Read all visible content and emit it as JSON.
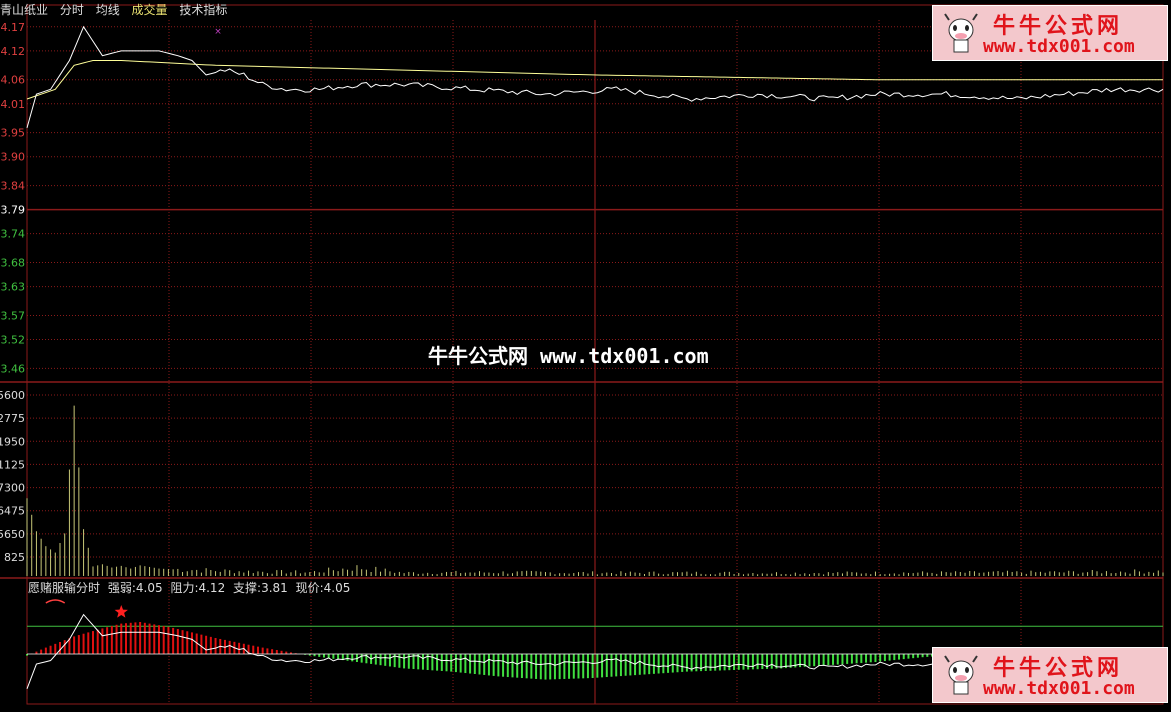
{
  "header": {
    "stock_name": "青山纸业",
    "tab_minute": "分时",
    "tab_avg": "均线",
    "tab_volume": "成交量",
    "tab_tech": "技术指标"
  },
  "indicator_header": {
    "name": "愿赌服输分时",
    "strength": "强弱:4.05",
    "resistance": "阻力:4.12",
    "support": "支撑:3.81",
    "current": "现价:4.05"
  },
  "watermark": "牛牛公式网 www.tdx001.com",
  "logos": [
    {
      "title": "牛牛公式网",
      "url": "www.tdx001.com"
    },
    {
      "title": "牛牛公式网",
      "url": "www.tdx001.com"
    }
  ],
  "colors": {
    "background": "#000000",
    "grid": "#8b1a1a",
    "price_line": "#ffffff",
    "avg_line": "#ffff99",
    "up_axis": "#e04040",
    "down_axis": "#40c040",
    "pre_close": "#ffffff",
    "volume": "#c8c878",
    "ind_red": "#e01010",
    "ind_green": "#40e040",
    "ind_ref": "#40c040"
  },
  "chart_data": [
    {
      "type": "line",
      "title": "青山纸业 分时",
      "price_ticks": [
        "4.17",
        "4.12",
        "4.06",
        "4.01",
        "3.95",
        "3.90",
        "3.84",
        "3.79",
        "3.74",
        "3.68",
        "3.63",
        "3.57",
        "3.52",
        "3.46"
      ],
      "pre_close": 3.79,
      "ylim": [
        3.44,
        4.18
      ],
      "grid": true,
      "series": [
        {
          "name": "分时",
          "anchors": [
            [
              0,
              3.96
            ],
            [
              2,
              4.03
            ],
            [
              5,
              4.04
            ],
            [
              9,
              4.1
            ],
            [
              12,
              4.17
            ],
            [
              16,
              4.11
            ],
            [
              20,
              4.12
            ],
            [
              24,
              4.12
            ],
            [
              28,
              4.12
            ],
            [
              32,
              4.11
            ],
            [
              35,
              4.1
            ],
            [
              38,
              4.07
            ],
            [
              42,
              4.08
            ],
            [
              46,
              4.07
            ],
            [
              50,
              4.05
            ],
            [
              55,
              4.04
            ],
            [
              62,
              4.04
            ],
            [
              70,
              4.05
            ],
            [
              80,
              4.05
            ],
            [
              95,
              4.04
            ],
            [
              110,
              4.03
            ],
            [
              125,
              4.04
            ],
            [
              140,
              4.02
            ],
            [
              155,
              4.03
            ],
            [
              170,
              4.02
            ],
            [
              180,
              4.03
            ],
            [
              195,
              4.03
            ],
            [
              210,
              4.02
            ],
            [
              220,
              4.03
            ],
            [
              230,
              4.04
            ],
            [
              241,
              4.04
            ]
          ]
        },
        {
          "name": "均线",
          "anchors": [
            [
              0,
              4.02
            ],
            [
              6,
              4.04
            ],
            [
              10,
              4.09
            ],
            [
              14,
              4.1
            ],
            [
              20,
              4.1
            ],
            [
              40,
              4.09
            ],
            [
              80,
              4.08
            ],
            [
              120,
              4.07
            ],
            [
              180,
              4.06
            ],
            [
              241,
              4.06
            ]
          ]
        }
      ]
    },
    {
      "type": "bar",
      "title": "成交量",
      "volume_ticks": [
        "5600",
        "2775",
        "1950",
        "1125",
        "7300",
        "6475",
        "5650",
        "825"
      ],
      "spikes": [
        [
          0,
          7300
        ],
        [
          2,
          4200
        ],
        [
          4,
          2800
        ],
        [
          6,
          2200
        ],
        [
          8,
          4000
        ],
        [
          10,
          16000
        ],
        [
          12,
          4400
        ],
        [
          14,
          900
        ],
        [
          16,
          1100
        ],
        [
          18,
          800
        ],
        [
          20,
          950
        ],
        [
          22,
          700
        ],
        [
          24,
          1000
        ],
        [
          26,
          850
        ],
        [
          28,
          700
        ],
        [
          30,
          650
        ],
        [
          34,
          600
        ],
        [
          40,
          500
        ],
        [
          50,
          400
        ],
        [
          60,
          350
        ],
        [
          70,
          800
        ],
        [
          80,
          300
        ],
        [
          100,
          350
        ],
        [
          120,
          300
        ],
        [
          140,
          300
        ],
        [
          160,
          280
        ],
        [
          180,
          300
        ],
        [
          200,
          320
        ],
        [
          220,
          350
        ],
        [
          241,
          450
        ]
      ],
      "vmax": 17000
    },
    {
      "type": "bar",
      "title": "愿赌服输分时",
      "resistance": 4.12,
      "support": 3.81,
      "current": 4.05,
      "strength": 4.05,
      "osc_anchors": [
        [
          0,
          -0.05
        ],
        [
          4,
          0.2
        ],
        [
          10,
          0.55
        ],
        [
          16,
          0.8
        ],
        [
          20,
          0.95
        ],
        [
          24,
          1.0
        ],
        [
          30,
          0.85
        ],
        [
          40,
          0.5
        ],
        [
          50,
          0.2
        ],
        [
          60,
          -0.05
        ],
        [
          70,
          -0.25
        ],
        [
          80,
          -0.45
        ],
        [
          90,
          -0.55
        ],
        [
          100,
          -0.7
        ],
        [
          110,
          -0.8
        ],
        [
          120,
          -0.75
        ],
        [
          130,
          -0.65
        ],
        [
          140,
          -0.55
        ],
        [
          150,
          -0.5
        ],
        [
          160,
          -0.45
        ],
        [
          170,
          -0.35
        ],
        [
          180,
          -0.25
        ],
        [
          190,
          -0.1
        ],
        [
          200,
          0.0
        ],
        [
          215,
          -0.05
        ],
        [
          230,
          -0.1
        ],
        [
          241,
          -0.15
        ]
      ]
    }
  ]
}
